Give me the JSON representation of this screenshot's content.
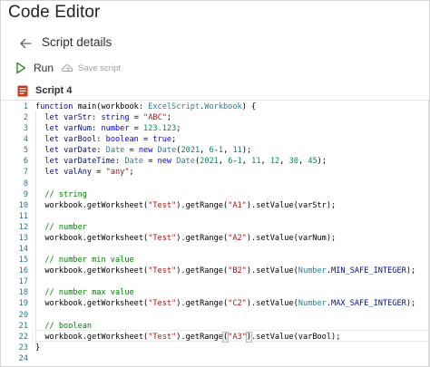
{
  "app": {
    "title": "Code Editor"
  },
  "header": {
    "title": "Script details",
    "back_icon": "arrow-left-icon"
  },
  "toolbar": {
    "run_label": "Run",
    "run_icon": "play-icon",
    "save_label": "Save script",
    "save_icon": "cloud-sync-icon",
    "save_enabled": false
  },
  "script": {
    "name": "Script 4",
    "icon": "script-file-icon"
  },
  "editor": {
    "current_line": 22,
    "lines": [
      {
        "number": "1",
        "tokens": [
          [
            "kw",
            "function "
          ],
          [
            "plain",
            "main(workbook: "
          ],
          [
            "type",
            "ExcelScript"
          ],
          [
            "plain",
            "."
          ],
          [
            "type",
            "Workbook"
          ],
          [
            "plain",
            ") {"
          ]
        ]
      },
      {
        "number": "2",
        "tokens": [
          [
            "plain",
            "  "
          ],
          [
            "kw",
            "let "
          ],
          [
            "var",
            "varStr"
          ],
          [
            "plain",
            ": "
          ],
          [
            "kw",
            "string"
          ],
          [
            "plain",
            " = "
          ],
          [
            "str",
            "\"ABC\""
          ],
          [
            "plain",
            ";"
          ]
        ]
      },
      {
        "number": "3",
        "tokens": [
          [
            "plain",
            "  "
          ],
          [
            "kw",
            "let "
          ],
          [
            "var",
            "varNum"
          ],
          [
            "plain",
            ": "
          ],
          [
            "kw",
            "number"
          ],
          [
            "plain",
            " = "
          ],
          [
            "num",
            "123.123"
          ],
          [
            "plain",
            ";"
          ]
        ]
      },
      {
        "number": "4",
        "tokens": [
          [
            "plain",
            "  "
          ],
          [
            "kw",
            "let "
          ],
          [
            "var",
            "varBool"
          ],
          [
            "plain",
            ": "
          ],
          [
            "kw",
            "boolean"
          ],
          [
            "plain",
            " = "
          ],
          [
            "kw",
            "true"
          ],
          [
            "plain",
            ";"
          ]
        ]
      },
      {
        "number": "5",
        "tokens": [
          [
            "plain",
            "  "
          ],
          [
            "kw",
            "let "
          ],
          [
            "var",
            "varDate"
          ],
          [
            "plain",
            ": "
          ],
          [
            "type",
            "Date"
          ],
          [
            "plain",
            " = "
          ],
          [
            "kw",
            "new "
          ],
          [
            "type",
            "Date"
          ],
          [
            "plain",
            "("
          ],
          [
            "num",
            "2021"
          ],
          [
            "plain",
            ", "
          ],
          [
            "num",
            "6"
          ],
          [
            "plain",
            "-"
          ],
          [
            "num",
            "1"
          ],
          [
            "plain",
            ", "
          ],
          [
            "num",
            "11"
          ],
          [
            "plain",
            ");"
          ]
        ]
      },
      {
        "number": "6",
        "tokens": [
          [
            "plain",
            "  "
          ],
          [
            "kw",
            "let "
          ],
          [
            "var",
            "varDateTime"
          ],
          [
            "plain",
            ": "
          ],
          [
            "type",
            "Date"
          ],
          [
            "plain",
            " = "
          ],
          [
            "kw",
            "new "
          ],
          [
            "type",
            "Date"
          ],
          [
            "plain",
            "("
          ],
          [
            "num",
            "2021"
          ],
          [
            "plain",
            ", "
          ],
          [
            "num",
            "6"
          ],
          [
            "plain",
            "-"
          ],
          [
            "num",
            "1"
          ],
          [
            "plain",
            ", "
          ],
          [
            "num",
            "11"
          ],
          [
            "plain",
            ", "
          ],
          [
            "num",
            "12"
          ],
          [
            "plain",
            ", "
          ],
          [
            "num",
            "30"
          ],
          [
            "plain",
            ", "
          ],
          [
            "num",
            "45"
          ],
          [
            "plain",
            ");"
          ]
        ]
      },
      {
        "number": "7",
        "tokens": [
          [
            "plain",
            "  "
          ],
          [
            "kw",
            "let "
          ],
          [
            "var",
            "valAny"
          ],
          [
            "plain",
            " = "
          ],
          [
            "str",
            "\"any\""
          ],
          [
            "plain",
            ";"
          ]
        ]
      },
      {
        "number": "8",
        "tokens": []
      },
      {
        "number": "9",
        "tokens": [
          [
            "plain",
            "  "
          ],
          [
            "com",
            "// string"
          ]
        ]
      },
      {
        "number": "10",
        "tokens": [
          [
            "plain",
            "  workbook.getWorksheet("
          ],
          [
            "str",
            "\"Test\""
          ],
          [
            "plain",
            ").getRange("
          ],
          [
            "str",
            "\"A1\""
          ],
          [
            "plain",
            ").setValue(varStr);"
          ]
        ]
      },
      {
        "number": "11",
        "tokens": []
      },
      {
        "number": "12",
        "tokens": [
          [
            "plain",
            "  "
          ],
          [
            "com",
            "// number"
          ]
        ]
      },
      {
        "number": "13",
        "tokens": [
          [
            "plain",
            "  workbook.getWorksheet("
          ],
          [
            "str",
            "\"Test\""
          ],
          [
            "plain",
            ").getRange("
          ],
          [
            "str",
            "\"A2\""
          ],
          [
            "plain",
            ").setValue(varNum);"
          ]
        ]
      },
      {
        "number": "14",
        "tokens": []
      },
      {
        "number": "15",
        "tokens": [
          [
            "plain",
            "  "
          ],
          [
            "com",
            "// number min value"
          ]
        ]
      },
      {
        "number": "16",
        "tokens": [
          [
            "plain",
            "  workbook.getWorksheet("
          ],
          [
            "str",
            "\"Test\""
          ],
          [
            "plain",
            ").getRange("
          ],
          [
            "str",
            "\"B2\""
          ],
          [
            "plain",
            ").setValue("
          ],
          [
            "type",
            "Number"
          ],
          [
            "plain",
            "."
          ],
          [
            "var",
            "MIN_SAFE_INTEGER"
          ],
          [
            "plain",
            ");"
          ]
        ]
      },
      {
        "number": "17",
        "tokens": []
      },
      {
        "number": "18",
        "tokens": [
          [
            "plain",
            "  "
          ],
          [
            "com",
            "// number max value"
          ]
        ]
      },
      {
        "number": "19",
        "tokens": [
          [
            "plain",
            "  workbook.getWorksheet("
          ],
          [
            "str",
            "\"Test\""
          ],
          [
            "plain",
            ").getRange("
          ],
          [
            "str",
            "\"C2\""
          ],
          [
            "plain",
            ").setValue("
          ],
          [
            "type",
            "Number"
          ],
          [
            "plain",
            "."
          ],
          [
            "var",
            "MAX_SAFE_INTEGER"
          ],
          [
            "plain",
            ");"
          ]
        ]
      },
      {
        "number": "20",
        "tokens": []
      },
      {
        "number": "21",
        "tokens": [
          [
            "plain",
            "  "
          ],
          [
            "com",
            "// boolean"
          ]
        ]
      },
      {
        "number": "22",
        "tokens": [
          [
            "plain",
            "  workbook.getWorksheet("
          ],
          [
            "str",
            "\"Test\""
          ],
          [
            "plain",
            ").getRange"
          ],
          [
            "bracket",
            "("
          ],
          [
            "str",
            "\"A3\""
          ],
          [
            "bracket",
            ")"
          ],
          [
            "plain",
            ".setValue(varBool);"
          ]
        ]
      },
      {
        "number": "23",
        "tokens": [
          [
            "plain",
            "}"
          ]
        ]
      },
      {
        "number": "24",
        "tokens": []
      }
    ]
  }
}
